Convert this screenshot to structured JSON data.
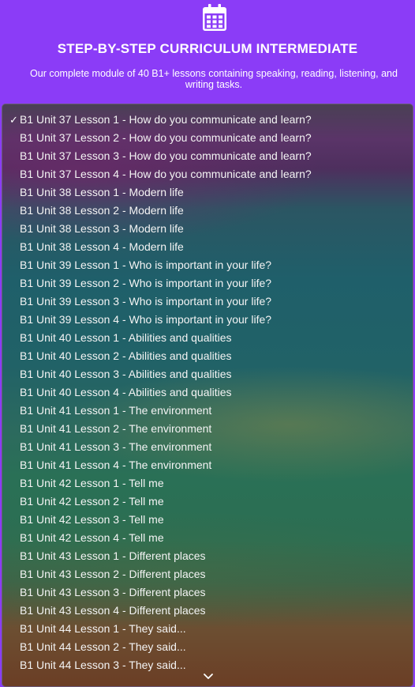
{
  "header": {
    "icon": "calendar-icon",
    "title": "STEP-BY-STEP CURRICULUM INTERMEDIATE",
    "subtitle": "Our complete module of 40 B1+ lessons containing speaking, reading, listening, and writing tasks."
  },
  "dropdown": {
    "selected_index": 0,
    "check_mark": "✓",
    "scroll_icon": "chevron-down-icon",
    "options": [
      "B1 Unit 37 Lesson 1 - How do you communicate and learn?",
      "B1 Unit 37 Lesson 2 - How do you communicate and learn?",
      "B1 Unit 37 Lesson 3 - How do you communicate and learn?",
      "B1 Unit 37 Lesson 4 - How do you communicate and learn?",
      "B1 Unit 38 Lesson 1 - Modern life",
      "B1 Unit 38 Lesson 2 - Modern life",
      "B1 Unit 38 Lesson 3 - Modern life",
      "B1 Unit 38 Lesson 4 - Modern life",
      "B1 Unit 39 Lesson 1 - Who is important in your life?",
      "B1 Unit 39 Lesson 2 - Who is important in your life?",
      "B1 Unit 39 Lesson 3 - Who is important in your life?",
      "B1 Unit 39 Lesson 4 - Who is important in your life?",
      "B1 Unit 40 Lesson 1 - Abilities and qualities",
      "B1 Unit 40 Lesson 2 - Abilities and qualities",
      "B1 Unit 40 Lesson 3 - Abilities and qualities",
      "B1 Unit 40 Lesson 4 - Abilities and qualities",
      "B1 Unit 41 Lesson 1 - The environment",
      "B1 Unit 41 Lesson 2 - The environment",
      "B1 Unit 41 Lesson 3 - The environment",
      "B1 Unit 41 Lesson 4 - The environment",
      "B1 Unit 42 Lesson 1 - Tell me",
      "B1 Unit 42 Lesson 2 - Tell me",
      "B1 Unit 42 Lesson 3 - Tell me",
      "B1 Unit 42 Lesson 4 - Tell me",
      "B1 Unit 43 Lesson 1 - Different places",
      "B1 Unit 43 Lesson 2 - Different places",
      "B1 Unit 43 Lesson 3 - Different places",
      "B1 Unit 43 Lesson 4 - Different places",
      "B1 Unit 44 Lesson 1 - They said...",
      "B1 Unit 44 Lesson 2 - They said...",
      "B1 Unit 44 Lesson 3 - They said..."
    ]
  },
  "colors": {
    "header_background": "#8b3cf7",
    "text": "#ffffff"
  }
}
